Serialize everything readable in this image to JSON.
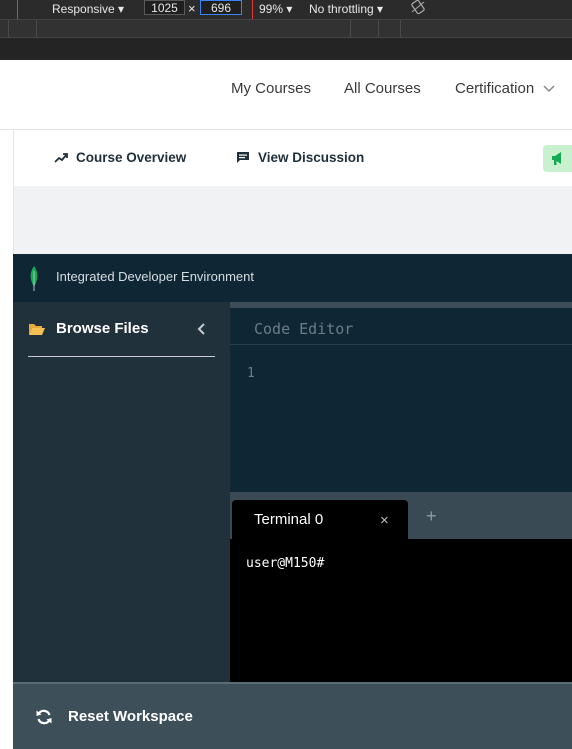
{
  "devtools": {
    "device": "Responsive",
    "width": "1025",
    "times": "×",
    "height": "696",
    "zoom": "99%",
    "throttling": "No throttling"
  },
  "nav": {
    "my_courses": "My Courses",
    "all_courses": "All Courses",
    "certification": "Certification"
  },
  "subnav": {
    "course_overview": "Course Overview",
    "view_discussion": "View Discussion"
  },
  "ide": {
    "title": "Integrated Developer Environment",
    "browse_files": "Browse Files",
    "code_editor": "Code Editor",
    "line_number": "1",
    "terminal_tab": "Terminal 0",
    "close_glyph": "×",
    "add_glyph": "+",
    "prompt": "user@M150#",
    "reset": "Reset Workspace"
  },
  "colors": {
    "ide_header": "#0f2634",
    "sidebar": "#21313c",
    "leaf_green": "#13aa52",
    "footer": "#3d4f58",
    "devtools_highlight": "#e53935"
  }
}
